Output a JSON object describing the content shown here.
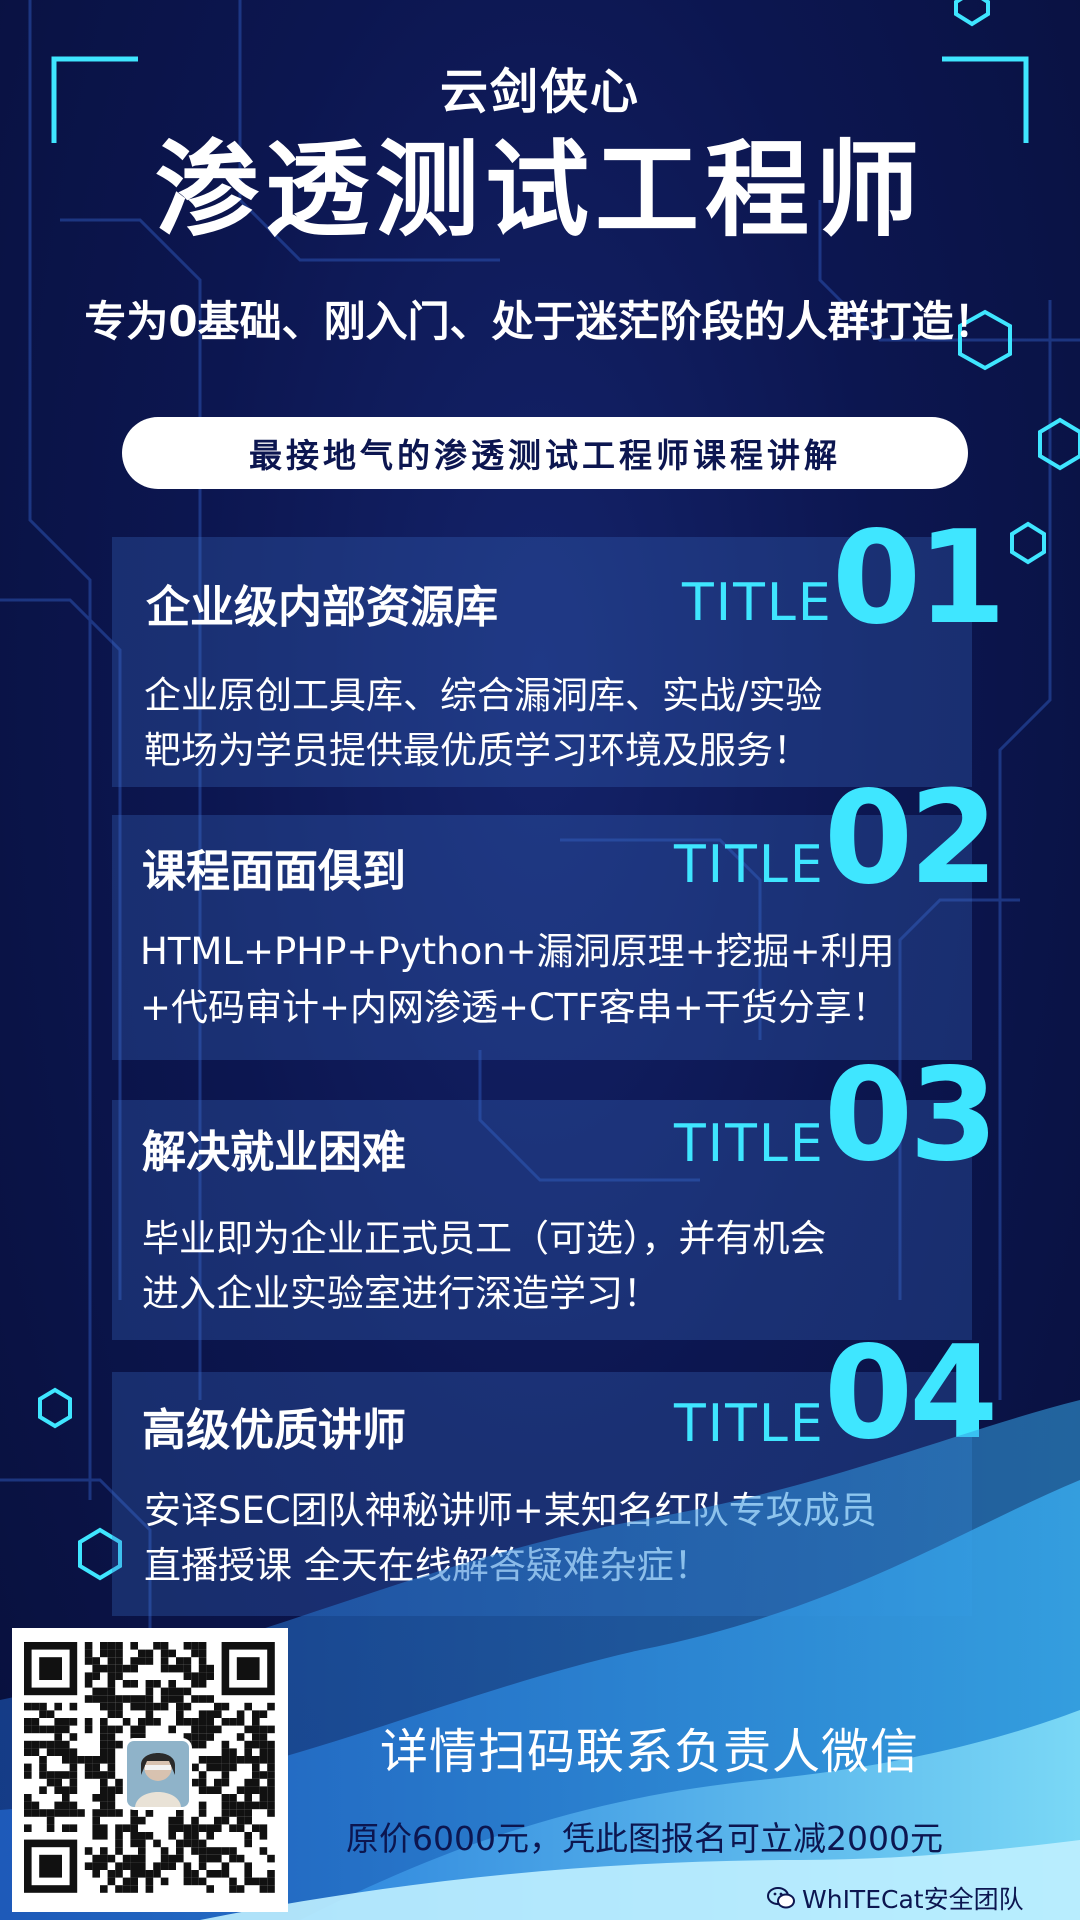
{
  "header": {
    "brand": "云剑侠心",
    "title": "渗透测试工程师",
    "subtitle": "专为0基础、刚入门、处于迷茫阶段的人群打造！",
    "tagline": "最接地气的渗透测试工程师课程讲解"
  },
  "cards": [
    {
      "heading": "企业级内部资源库",
      "tag": "TITLE",
      "number": "01",
      "lines": [
        "企业原创工具库、综合漏洞库、实战/实验",
        "靶场为学员提供最优质学习环境及服务！"
      ]
    },
    {
      "heading": "课程面面俱到",
      "tag": "TITLE",
      "number": "02",
      "lines": [
        "HTML+PHP+Python+漏洞原理+挖掘+利用",
        "+代码审计+内网渗透+CTF客串+干货分享！"
      ]
    },
    {
      "heading": "解决就业困难",
      "tag": "TITLE",
      "number": "03",
      "lines": [
        "毕业即为企业正式员工（可选），并有机会",
        "进入企业实验室进行深造学习！"
      ]
    },
    {
      "heading": "高级优质讲师",
      "tag": "TITLE",
      "number": "04",
      "lines": [
        "安译SEC团队神秘讲师+某知名红队专攻成员",
        "直播授课 全天在线解答疑难杂症！"
      ]
    }
  ],
  "footer": {
    "contact": "详情扫码联系负责人微信",
    "offer": "原价6000元，凭此图报名可立减2000元",
    "watermark": "WhITECat安全团队"
  },
  "colors": {
    "background": "#0c1650",
    "accent_cyan": "#3fe6ff",
    "card_fill": "#2e4f9a",
    "wave_light": "#4fc6f0"
  },
  "icons": [
    "qr-code",
    "wechat-icon"
  ]
}
